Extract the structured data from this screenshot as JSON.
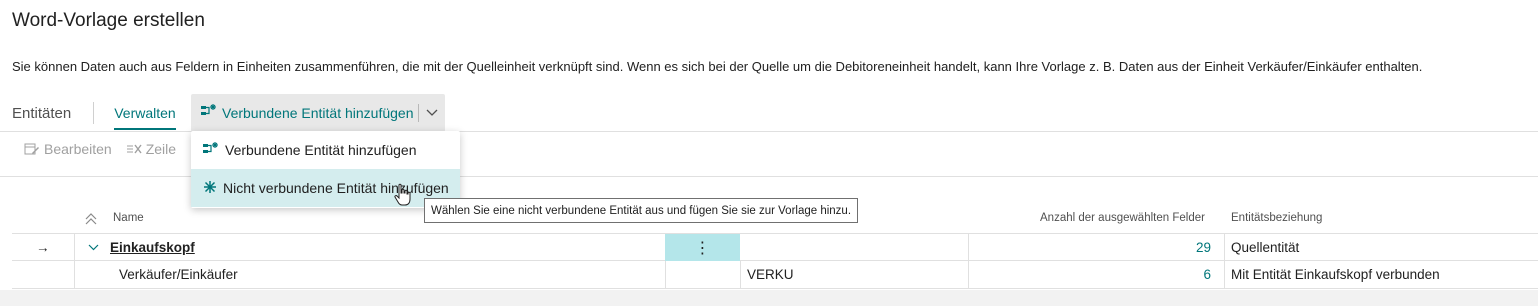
{
  "page": {
    "title": "Word-Vorlage erstellen",
    "description": "Sie können Daten auch aus Feldern in Einheiten zusammenführen, die mit der Quelleinheit verknüpft sind. Wenn es sich bei der Quelle um die Debitoreneinheit handelt, kann Ihre Vorlage z. B. Daten aus der Einheit Verkäufer/Einkäufer enthalten."
  },
  "tabs": {
    "title": "Entitäten",
    "manage": "Verwalten",
    "add_related": "Verbundene Entität hinzufügen"
  },
  "toolbar": {
    "edit": "Bearbeiten",
    "delete_row": "Zeile"
  },
  "dropdown": {
    "items": [
      {
        "label": "Verbundene Entität hinzufügen",
        "icon": "related-entity-icon"
      },
      {
        "label": "Nicht verbundene Entität hinzufügen",
        "icon": "unrelated-entity-icon"
      }
    ]
  },
  "tooltip": "Wählen Sie eine nicht verbundene Entität aus und fügen Sie sie zur Vorlage hinzu.",
  "table": {
    "columns": {
      "name": "Name",
      "count": "Anzahl der ausgewählten Felder",
      "relation": "Entitätsbeziehung"
    },
    "rows": [
      {
        "arrow": "→",
        "name": "Einkaufskopf",
        "code": "",
        "count": "29",
        "relation": "Quellentität",
        "menu": "⋮"
      },
      {
        "arrow": "",
        "name": "Verkäufer/Einkäufer",
        "code": "VERKU",
        "count": "6",
        "relation": "Mit Entität Einkaufskopf verbunden",
        "menu": ""
      }
    ]
  },
  "colors": {
    "accent": "#00767a",
    "selected_cell": "#b4e6ea",
    "menu_hover": "#d4edee"
  }
}
